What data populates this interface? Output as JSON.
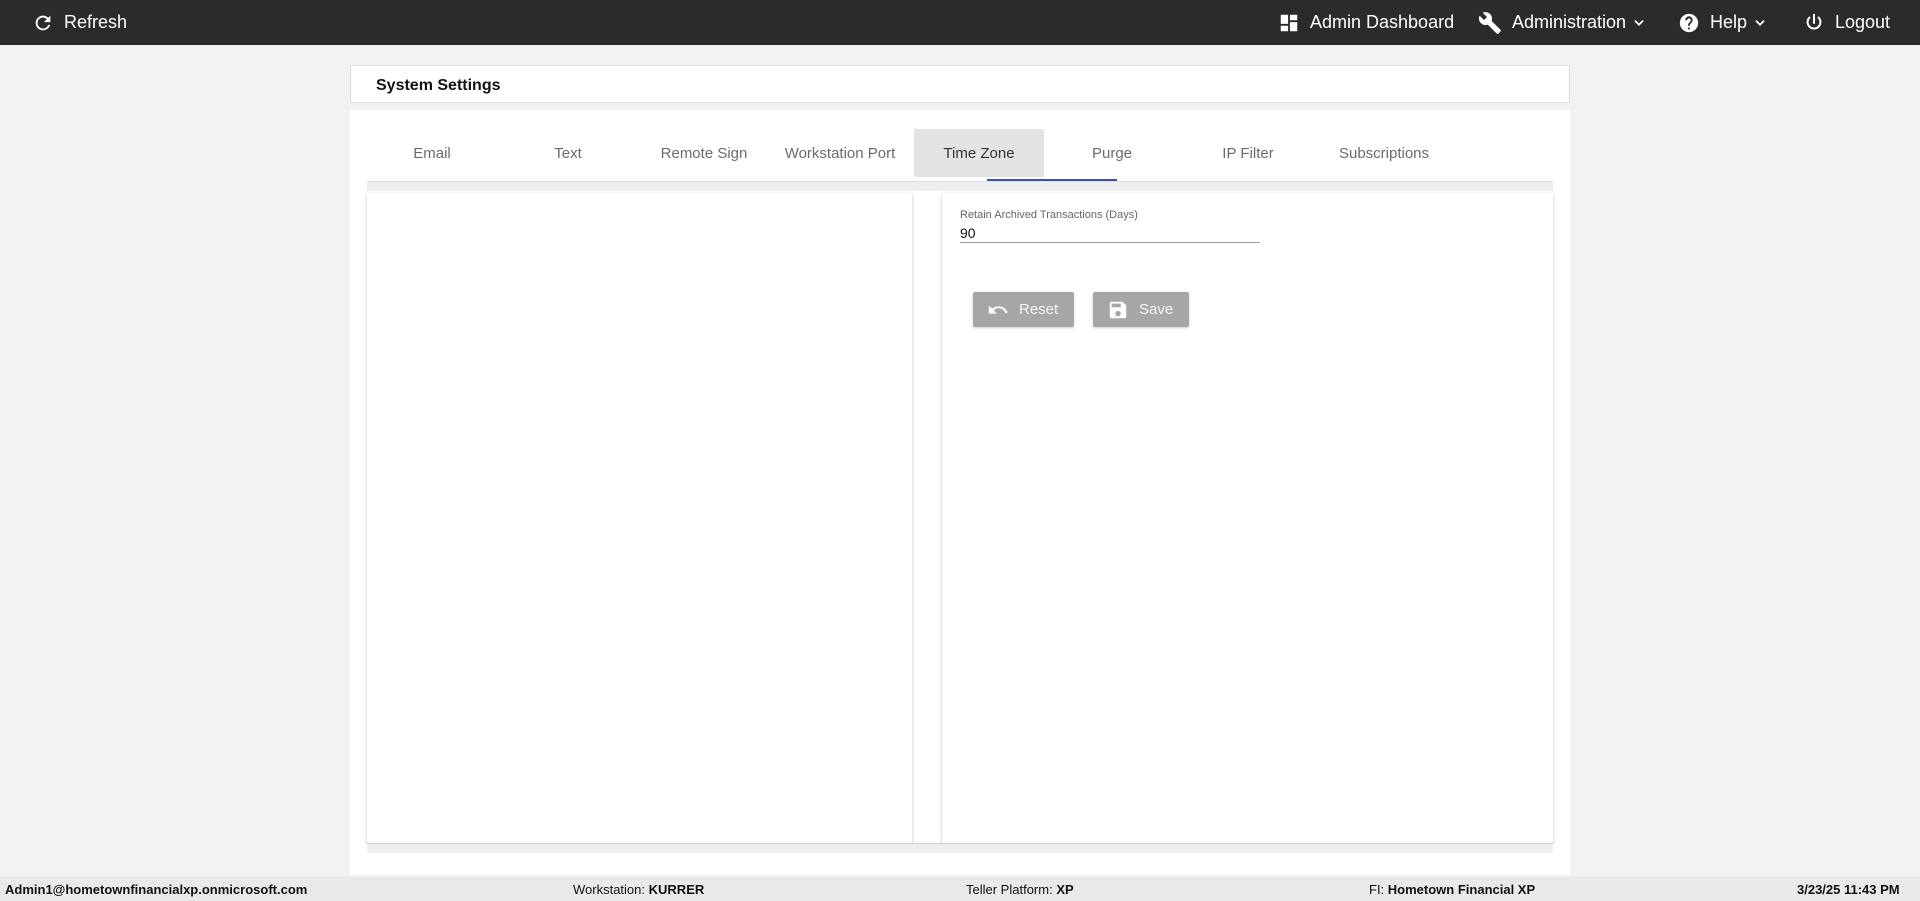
{
  "topbar": {
    "refresh": {
      "label": "Refresh",
      "icon": "refresh-icon"
    },
    "admin_dashboard": {
      "label": "Admin Dashboard",
      "icon": "dashboard-icon"
    },
    "administration": {
      "label": "Administration",
      "icon": "wrench-icon"
    },
    "help": {
      "label": "Help",
      "icon": "help-circle-icon"
    },
    "logout": {
      "label": "Logout",
      "icon": "power-icon"
    }
  },
  "page": {
    "title": "System Settings"
  },
  "tabs": [
    {
      "label": "Email"
    },
    {
      "label": "Text"
    },
    {
      "label": "Remote Sign"
    },
    {
      "label": "Workstation Port"
    },
    {
      "label": "Time Zone"
    },
    {
      "label": "Purge"
    },
    {
      "label": "IP Filter"
    },
    {
      "label": "Subscriptions"
    }
  ],
  "purge_form": {
    "retain_label": "Retain Archived Transactions (Days)",
    "retain_value": "90",
    "reset_label": "Reset",
    "save_label": "Save"
  },
  "status": {
    "user": "Admin1@hometownfinancialxp.onmicrosoft.com",
    "workstation_label": "Workstation:",
    "workstation_value": "KURRER",
    "platform_label": "Teller Platform:",
    "platform_value": "XP",
    "fi_label": "FI:",
    "fi_value": "Hometown Financial XP",
    "datetime": "3/23/25 11:43 PM"
  },
  "colors": {
    "topbar": "#2b2b2b",
    "tab_indicator": "#3f51b5",
    "button": "#a6a6a6"
  }
}
